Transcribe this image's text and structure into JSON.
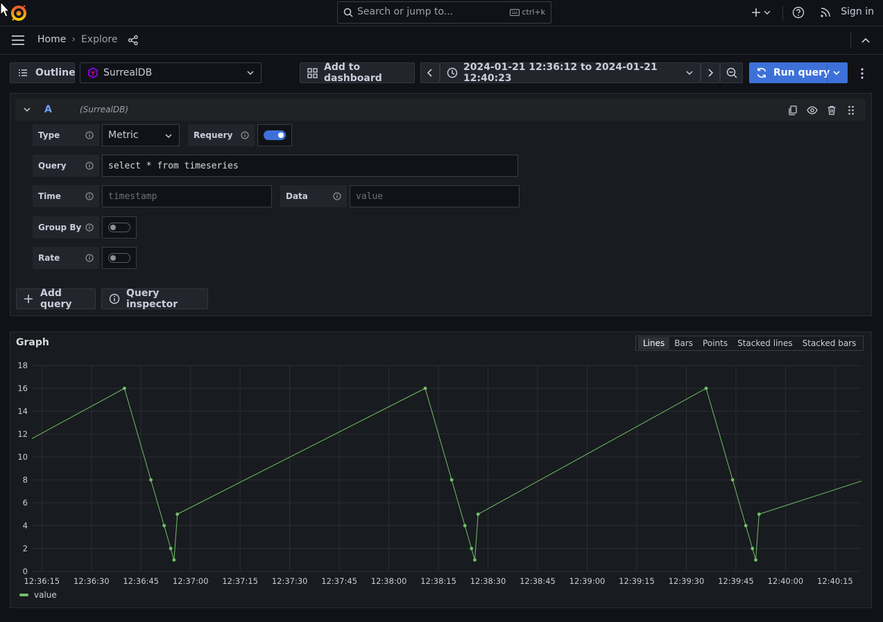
{
  "topbar": {
    "search_placeholder": "Search or jump to...",
    "shortcut": "ctrl+k",
    "sign_in": "Sign in"
  },
  "breadcrumb": {
    "home": "Home",
    "separator": "›",
    "current": "Explore"
  },
  "toolbar": {
    "outline": "Outline",
    "datasource": "SurrealDB",
    "add_to_dashboard": "Add to dashboard",
    "time_range": "2024-01-21 12:36:12 to 2024-01-21 12:40:23",
    "run_query": "Run query"
  },
  "query": {
    "ref_id": "A",
    "datasource_tag": "(SurrealDB)",
    "type_label": "Type",
    "type_value": "Metric",
    "requery_label": "Requery",
    "requery_on": true,
    "query_label": "Query",
    "query_value": "select * from timeseries",
    "time_label": "Time",
    "time_placeholder": "timestamp",
    "data_label": "Data",
    "data_placeholder": "value",
    "groupby_label": "Group By",
    "groupby_on": false,
    "rate_label": "Rate",
    "rate_on": false,
    "add_query": "Add query",
    "query_inspector": "Query inspector"
  },
  "graph": {
    "title": "Graph",
    "modes": [
      "Lines",
      "Bars",
      "Points",
      "Stacked lines",
      "Stacked bars"
    ],
    "active_mode": "Lines",
    "legend": "value",
    "line_color": "#73bf69"
  },
  "chart_data": {
    "type": "line",
    "xlabel": "",
    "ylabel": "",
    "x_ticks": [
      "12:36:15",
      "12:36:30",
      "12:36:45",
      "12:37:00",
      "12:37:15",
      "12:37:30",
      "12:37:45",
      "12:38:00",
      "12:38:15",
      "12:38:30",
      "12:38:45",
      "12:39:00",
      "12:39:15",
      "12:39:30",
      "12:39:45",
      "12:40:00",
      "12:40:15"
    ],
    "y_ticks": [
      0,
      2,
      4,
      6,
      8,
      10,
      12,
      14,
      16,
      18
    ],
    "ylim": [
      0,
      18
    ],
    "xlim": [
      "12:36:12",
      "12:40:23"
    ],
    "grid": true,
    "legend_position": "bottom-left",
    "series": [
      {
        "name": "value",
        "color": "#73bf69",
        "points": [
          {
            "x": "12:36:12",
            "y": 11.6,
            "marker": false
          },
          {
            "x": "12:36:40",
            "y": 16
          },
          {
            "x": "12:36:48",
            "y": 8
          },
          {
            "x": "12:36:52",
            "y": 4
          },
          {
            "x": "12:36:54",
            "y": 2
          },
          {
            "x": "12:36:55",
            "y": 1
          },
          {
            "x": "12:36:56",
            "y": 5
          },
          {
            "x": "12:38:11",
            "y": 16
          },
          {
            "x": "12:38:19",
            "y": 8
          },
          {
            "x": "12:38:23",
            "y": 4
          },
          {
            "x": "12:38:25",
            "y": 2
          },
          {
            "x": "12:38:26",
            "y": 1
          },
          {
            "x": "12:38:27",
            "y": 5
          },
          {
            "x": "12:39:36",
            "y": 16
          },
          {
            "x": "12:39:44",
            "y": 8
          },
          {
            "x": "12:39:48",
            "y": 4
          },
          {
            "x": "12:39:50",
            "y": 2
          },
          {
            "x": "12:39:51",
            "y": 1
          },
          {
            "x": "12:39:52",
            "y": 5
          },
          {
            "x": "12:40:23",
            "y": 7.9,
            "marker": false
          }
        ]
      }
    ]
  }
}
